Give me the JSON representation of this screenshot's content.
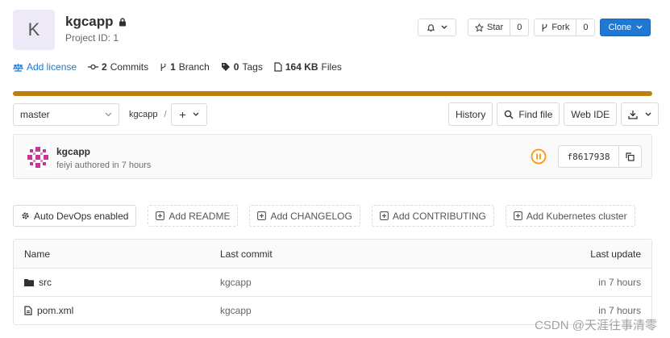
{
  "project": {
    "avatar_letter": "K",
    "name": "kgcapp",
    "id_text": "Project ID: 1"
  },
  "header_buttons": {
    "star_label": "Star",
    "star_count": "0",
    "fork_label": "Fork",
    "fork_count": "0",
    "clone_label": "Clone"
  },
  "stats": {
    "license": "Add license",
    "commits_count": "2",
    "commits_label": "Commits",
    "branches_count": "1",
    "branches_label": "Branch",
    "tags_count": "0",
    "tags_label": "Tags",
    "files_size": "164 KB",
    "files_label": "Files"
  },
  "toolbar": {
    "branch": "master",
    "path_root": "kgcapp",
    "path_sep": "/",
    "add_symbol": "+",
    "history": "History",
    "find_file": "Find file",
    "web_ide": "Web IDE"
  },
  "commit": {
    "title": "kgcapp",
    "author": "feiyi",
    "meta": "authored in 7 hours",
    "sha": "f8617938"
  },
  "quick_actions": {
    "auto_devops": "Auto DevOps enabled",
    "readme": "Add README",
    "changelog": "Add CHANGELOG",
    "contributing": "Add CONTRIBUTING",
    "kubernetes": "Add Kubernetes cluster"
  },
  "table": {
    "headers": {
      "name": "Name",
      "last_commit": "Last commit",
      "last_update": "Last update"
    },
    "rows": [
      {
        "name": "src",
        "type": "folder-icon",
        "commit": "kgcapp",
        "updated": "in 7 hours"
      },
      {
        "name": "pom.xml",
        "type": "file-icon",
        "commit": "kgcapp",
        "updated": "in 7 hours"
      }
    ]
  },
  "watermark": "CSDN @天涯往事清零",
  "colors": {
    "primary": "#1f78d1",
    "progress": "#c17d10",
    "status": "#fc9403"
  }
}
